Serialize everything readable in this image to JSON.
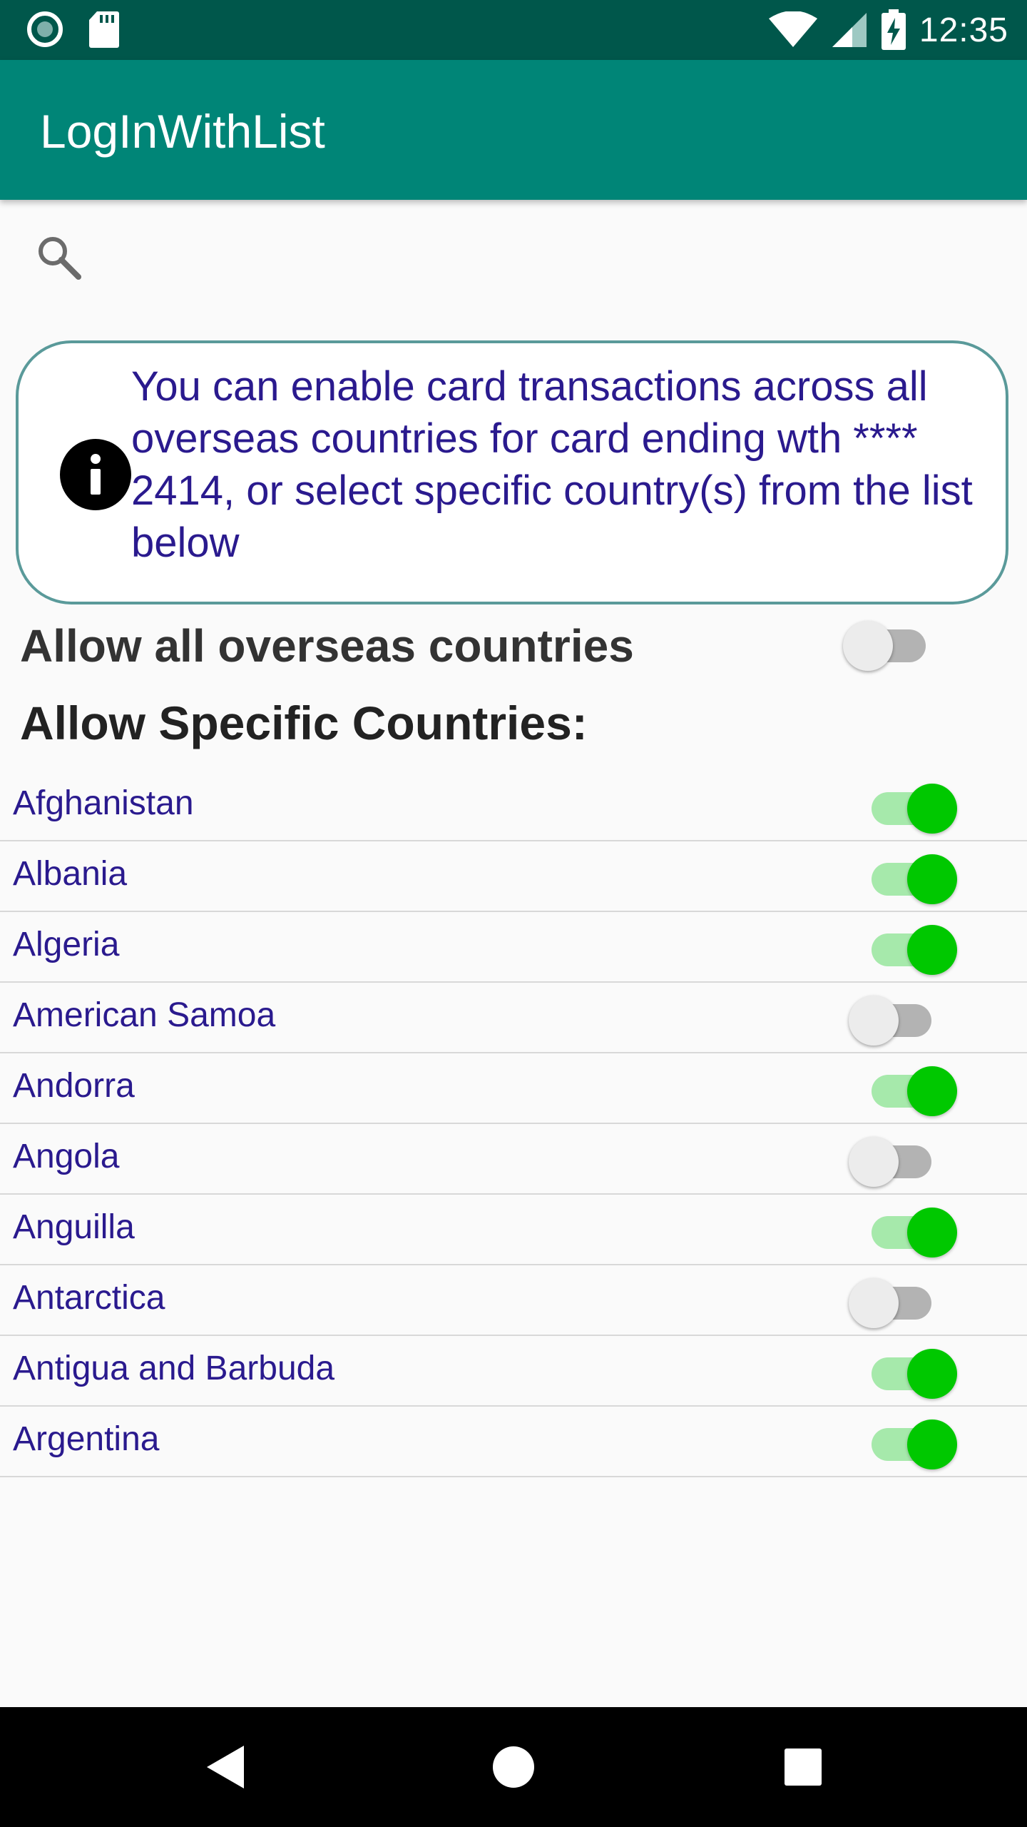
{
  "status_bar": {
    "time": "12:35",
    "icons": [
      "camera-icon",
      "sd-card-icon",
      "wifi-icon",
      "signal-icon",
      "battery-charging-icon"
    ]
  },
  "app_bar": {
    "title": "LogInWithList"
  },
  "search": {
    "icon": "search-icon"
  },
  "info": {
    "icon": "info-icon",
    "text": "You can enable card transactions across all overseas countries for card ending wth **** 2414, or select specific country(s) from the list below"
  },
  "allow_all": {
    "label": "Allow all overseas countries",
    "enabled": false
  },
  "specific": {
    "title": "Allow Specific Countries:"
  },
  "countries": [
    {
      "name": "Afghanistan",
      "enabled": true
    },
    {
      "name": "Albania",
      "enabled": true
    },
    {
      "name": "Algeria",
      "enabled": true
    },
    {
      "name": "American Samoa",
      "enabled": false
    },
    {
      "name": "Andorra",
      "enabled": true
    },
    {
      "name": "Angola",
      "enabled": false
    },
    {
      "name": "Anguilla",
      "enabled": true
    },
    {
      "name": "Antarctica",
      "enabled": false
    },
    {
      "name": "Antigua and Barbuda",
      "enabled": true
    },
    {
      "name": "Argentina",
      "enabled": true
    }
  ],
  "colors": {
    "status_bar": "#00574b",
    "app_bar": "#008577",
    "text_accent": "#2a1a8e",
    "switch_on_thumb": "#00c800",
    "switch_on_track": "#a6e9ab"
  },
  "nav_bar": {
    "icons": [
      "back-icon",
      "home-icon",
      "recents-icon"
    ]
  }
}
